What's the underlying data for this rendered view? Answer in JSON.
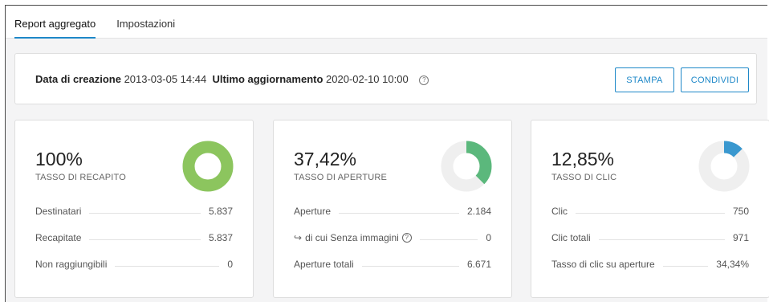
{
  "tabs": [
    {
      "label": "Report aggregato",
      "active": true
    },
    {
      "label": "Impostazioni",
      "active": false
    }
  ],
  "info": {
    "created_label": "Data di creazione",
    "created_value": "2013-03-05 14:44",
    "updated_label": "Ultimo aggiornamento",
    "updated_value": "2020-02-10 10:00",
    "help_icon": "question-circle-icon"
  },
  "actions": {
    "print_label": "STAMPA",
    "share_label": "CONDIVIDI"
  },
  "colors": {
    "accent": "#1e88c8",
    "delivery": "#8cc55e",
    "opens": "#5bb87c",
    "clicks": "#3a98cf",
    "donut_track": "#efefef"
  },
  "cards": [
    {
      "percent": "100%",
      "label": "TASSO DI RECAPITO",
      "fraction": 1.0,
      "rows": [
        {
          "label": "Destinatari",
          "value": "5.837"
        },
        {
          "label": "Recapitate",
          "value": "5.837"
        },
        {
          "label": "Non raggiungibili",
          "value": "0"
        }
      ]
    },
    {
      "percent": "37,42%",
      "label": "TASSO DI APERTURE",
      "fraction": 0.3742,
      "rows": [
        {
          "label": "Aperture",
          "value": "2.184"
        },
        {
          "label": "di cui Senza immagini",
          "value": "0"
        },
        {
          "label": "Aperture totali",
          "value": "6.671"
        }
      ]
    },
    {
      "percent": "12,85%",
      "label": "TASSO DI CLIC",
      "fraction": 0.1285,
      "rows": [
        {
          "label": "Clic",
          "value": "750"
        },
        {
          "label": "Clic totali",
          "value": "971"
        },
        {
          "label": "Tasso di clic su aperture",
          "value": "34,34%"
        }
      ]
    }
  ]
}
